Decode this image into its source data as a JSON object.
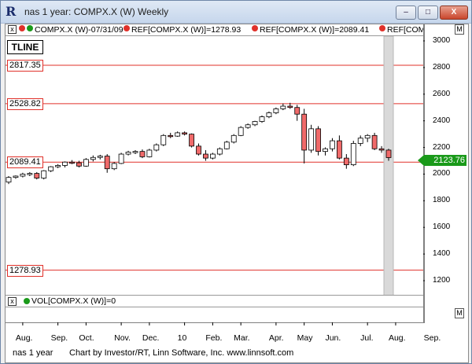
{
  "window": {
    "title": "nas 1 year: COMPX.X (W) Weekly",
    "minimize_label": "–",
    "maximize_label": "□",
    "close_label": "X"
  },
  "legend": {
    "close_box": "x",
    "items": [
      {
        "text": "COMPX.X (W)-07/31/09",
        "dot_color": "#1a9a1a"
      },
      {
        "text": "REF[COMPX.X (W)]=1278.93",
        "dot_color": "#e0312a"
      },
      {
        "text": "REF[COMPX.X (W)]=2089.41",
        "dot_color": "#e0312a"
      },
      {
        "text": "REF[COMPX.X (W)]",
        "dot_color": "#e0312a"
      }
    ],
    "m_box": "M"
  },
  "tline_label": "TLINE",
  "ref_lines": [
    {
      "label": "2817.35",
      "value": 2817.35
    },
    {
      "label": "2528.82",
      "value": 2528.82
    },
    {
      "label": "2089.41",
      "value": 2089.41
    },
    {
      "label": "1278.93",
      "value": 1278.93
    }
  ],
  "last_price": {
    "label": "2123.76",
    "value": 2123.76,
    "color": "#1a9a1a"
  },
  "volume_legend": {
    "close_box": "x",
    "text": "VOL[COMPX.X (W)]=0",
    "dot_color": "#1a9a1a",
    "m_box": "M"
  },
  "status_bar": {
    "left": "nas 1 year",
    "right": "Chart by Investor/RT, Linn Software, Inc. www.linnsoft.com"
  },
  "chart_data": {
    "type": "candlestick",
    "ylim": [
      1100,
      3050
    ],
    "y_ticks": [
      1200,
      1400,
      1600,
      1800,
      2000,
      2200,
      2400,
      2600,
      2800,
      3000
    ],
    "x_tick_labels": [
      "Aug.",
      "Sep.",
      "Oct.",
      "Nov.",
      "Dec.",
      "10",
      "Feb.",
      "Mar.",
      "Apr.",
      "May",
      "Jun.",
      "Jul.",
      "Aug.",
      "Sep."
    ],
    "x_tick_index": [
      2,
      7,
      11,
      16,
      20,
      25,
      29,
      33,
      38,
      42,
      46,
      51,
      55,
      60
    ],
    "candles": [
      [
        1940,
        1985,
        1925,
        1975
      ],
      [
        1975,
        1990,
        1965,
        1985
      ],
      [
        1985,
        2010,
        1975,
        2000
      ],
      [
        2000,
        2015,
        1985,
        2005
      ],
      [
        2005,
        2015,
        1960,
        1970
      ],
      [
        1970,
        2030,
        1960,
        2025
      ],
      [
        2025,
        2060,
        2015,
        2055
      ],
      [
        2055,
        2075,
        2045,
        2065
      ],
      [
        2065,
        2095,
        2050,
        2090
      ],
      [
        2090,
        2105,
        2075,
        2085
      ],
      [
        2085,
        2100,
        2050,
        2060
      ],
      [
        2060,
        2120,
        2055,
        2110
      ],
      [
        2110,
        2140,
        2095,
        2125
      ],
      [
        2125,
        2145,
        2110,
        2135
      ],
      [
        2135,
        2150,
        2010,
        2040
      ],
      [
        2040,
        2090,
        2030,
        2080
      ],
      [
        2080,
        2160,
        2075,
        2150
      ],
      [
        2150,
        2175,
        2140,
        2165
      ],
      [
        2165,
        2180,
        2150,
        2170
      ],
      [
        2170,
        2185,
        2120,
        2130
      ],
      [
        2130,
        2190,
        2125,
        2180
      ],
      [
        2180,
        2230,
        2170,
        2220
      ],
      [
        2220,
        2300,
        2210,
        2290
      ],
      [
        2290,
        2310,
        2270,
        2285
      ],
      [
        2285,
        2320,
        2280,
        2310
      ],
      [
        2310,
        2320,
        2290,
        2300
      ],
      [
        2300,
        2305,
        2200,
        2210
      ],
      [
        2210,
        2230,
        2140,
        2150
      ],
      [
        2150,
        2180,
        2100,
        2120
      ],
      [
        2120,
        2160,
        2110,
        2150
      ],
      [
        2150,
        2200,
        2140,
        2190
      ],
      [
        2190,
        2250,
        2185,
        2240
      ],
      [
        2240,
        2300,
        2230,
        2290
      ],
      [
        2290,
        2360,
        2285,
        2350
      ],
      [
        2350,
        2380,
        2340,
        2370
      ],
      [
        2370,
        2400,
        2360,
        2395
      ],
      [
        2395,
        2440,
        2385,
        2430
      ],
      [
        2430,
        2470,
        2420,
        2460
      ],
      [
        2460,
        2500,
        2450,
        2490
      ],
      [
        2490,
        2530,
        2480,
        2510
      ],
      [
        2510,
        2535,
        2490,
        2500
      ],
      [
        2500,
        2520,
        2400,
        2450
      ],
      [
        2450,
        2490,
        2080,
        2180
      ],
      [
        2180,
        2370,
        2160,
        2340
      ],
      [
        2340,
        2360,
        2140,
        2170
      ],
      [
        2170,
        2200,
        2140,
        2190
      ],
      [
        2190,
        2270,
        2170,
        2250
      ],
      [
        2250,
        2290,
        2110,
        2120
      ],
      [
        2120,
        2150,
        2040,
        2070
      ],
      [
        2070,
        2250,
        2060,
        2230
      ],
      [
        2230,
        2290,
        2210,
        2270
      ],
      [
        2270,
        2300,
        2240,
        2290
      ],
      [
        2290,
        2310,
        2180,
        2190
      ],
      [
        2190,
        2210,
        2160,
        2180
      ],
      [
        2180,
        2190,
        2100,
        2123.76
      ]
    ]
  }
}
